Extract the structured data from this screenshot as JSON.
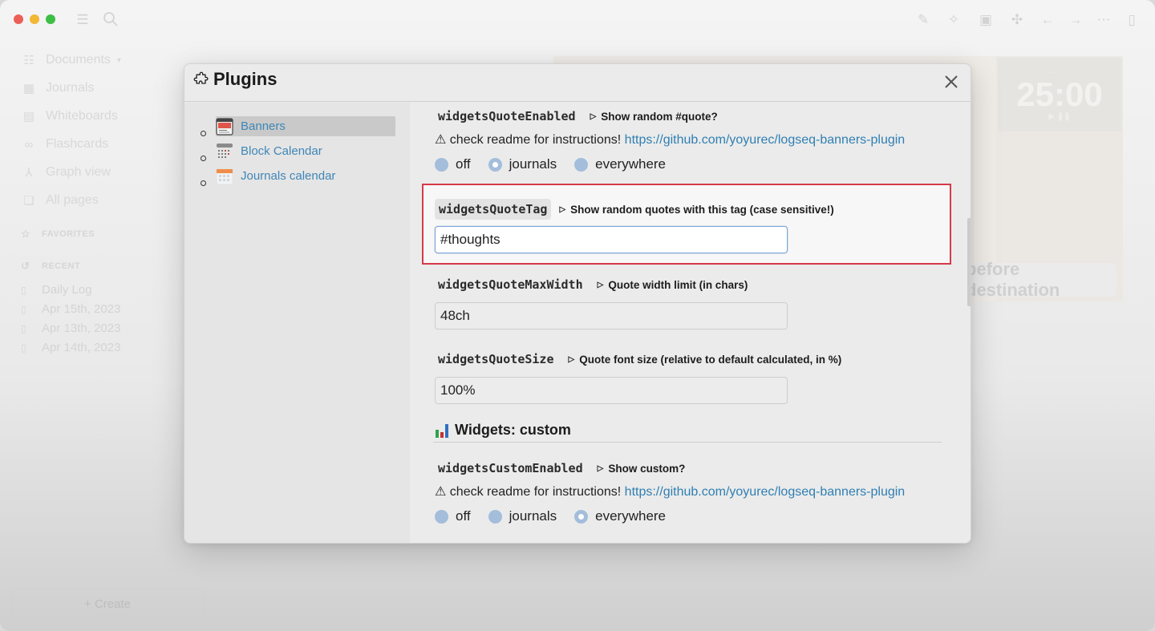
{
  "window": {
    "traffic_lights": [
      "close",
      "minimize",
      "maximize"
    ],
    "toolbar_left_icons": [
      "menu-icon",
      "search-icon"
    ],
    "toolbar_right_icons": [
      "pencil-icon",
      "sparkle-icon",
      "calendar-icon",
      "puzzle-icon",
      "arrow-left-icon",
      "arrow-right-icon",
      "more-icon",
      "sidebar-toggle-icon"
    ]
  },
  "left_sidebar": {
    "graph_name": "Documents",
    "nav": [
      {
        "label": "Journals",
        "icon": "calendar-icon"
      },
      {
        "label": "Whiteboards",
        "icon": "whiteboard-icon"
      },
      {
        "label": "Flashcards",
        "icon": "infinity-icon"
      },
      {
        "label": "Graph view",
        "icon": "graph-icon"
      },
      {
        "label": "All pages",
        "icon": "pages-icon"
      }
    ],
    "favorites_label": "FAVORITES",
    "recent_label": "RECENT",
    "recent": [
      "Daily Log",
      "Apr 15th, 2023",
      "Apr 13th, 2023",
      "Apr 14th, 2023"
    ],
    "create_label": "+ Create"
  },
  "background": {
    "timer_value": "25:00",
    "banner_text": "before destination"
  },
  "modal": {
    "title": "Plugins",
    "plugins": [
      {
        "label": "Banners",
        "active": true
      },
      {
        "label": "Block Calendar",
        "active": false
      },
      {
        "label": "Journals calendar",
        "active": false
      }
    ],
    "settings": [
      {
        "key": "widgetsQuoteEnabled",
        "description": "Show random #quote?",
        "note": "⚠ check readme for instructions!",
        "link": "https://github.com/yoyurec/logseq-banners-plugin",
        "options": [
          "off",
          "journals",
          "everywhere"
        ],
        "selected": "journals"
      },
      {
        "key": "widgetsQuoteTag",
        "description": "Show random quotes with this tag (case sensitive!)",
        "value": "#thoughts",
        "highlighted": true
      },
      {
        "key": "widgetsQuoteMaxWidth",
        "description": "Quote width limit (in chars)",
        "value": "48ch"
      },
      {
        "key": "widgetsQuoteSize",
        "description": "Quote font size (relative to default calculated, in %)",
        "value": "100%"
      }
    ],
    "section": {
      "icon": "bar-chart-icon",
      "title": "Widgets: custom"
    },
    "custom_setting": {
      "key": "widgetsCustomEnabled",
      "description": "Show custom?",
      "note": "⚠ check readme for instructions!",
      "link": "https://github.com/yoyurec/logseq-banners-plugin",
      "options": [
        "off",
        "journals",
        "everywhere"
      ],
      "selected": "everywhere"
    }
  },
  "colors": {
    "link": "#2f7fb2",
    "highlight_border": "#d6394a",
    "radio": "#a3bddb",
    "focus_border": "#7ea6d8"
  }
}
